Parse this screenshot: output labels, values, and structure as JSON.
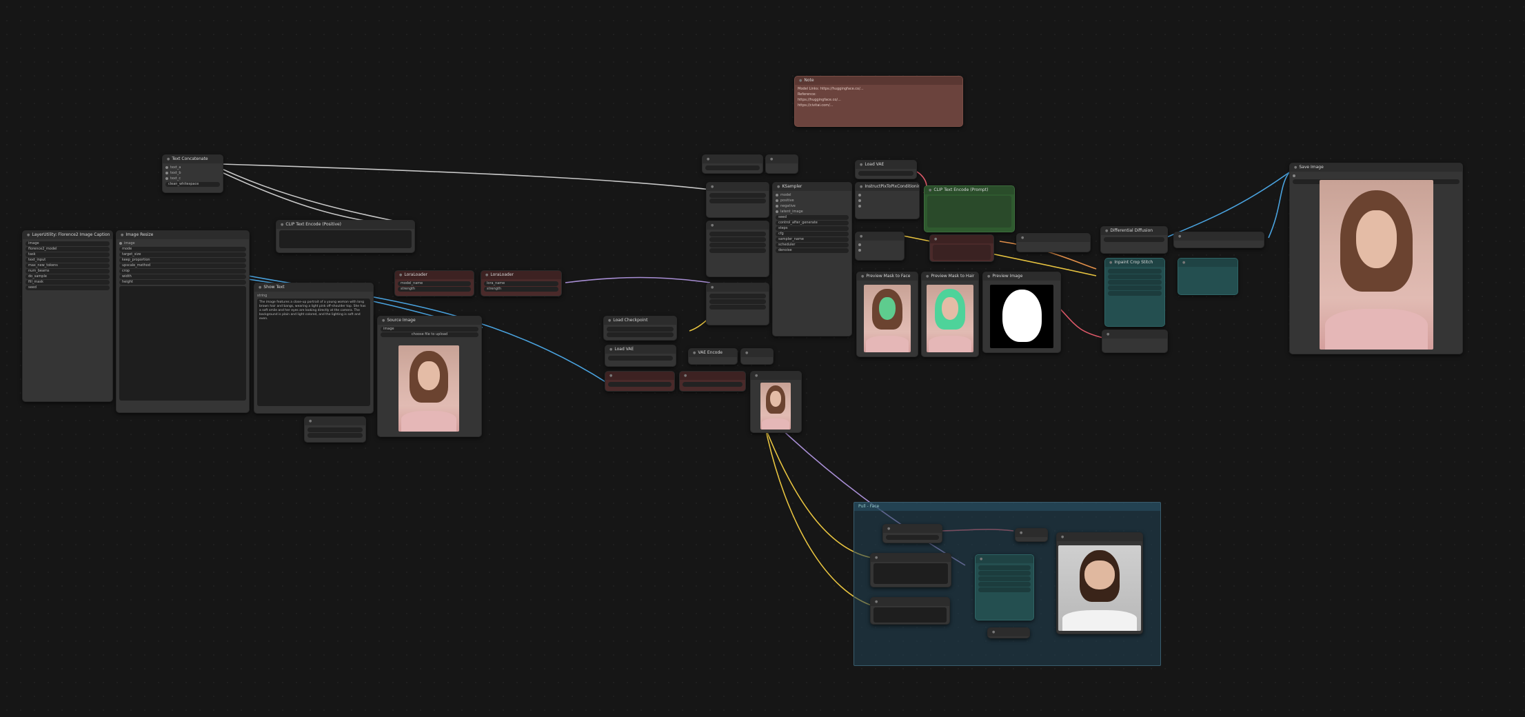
{
  "colors": {
    "background": "#161616",
    "group": "#244456",
    "note": "#6b433d",
    "green_node": "#2f5a2f",
    "teal_node": "#244f50",
    "red_node": "#4a2a2a",
    "wire_blue": "#4aa3df",
    "wire_yellow": "#e8c440",
    "wire_purple": "#a98fd6",
    "wire_red": "#e05a6a",
    "wire_white": "#bbbbbb"
  },
  "nodes": {
    "text_concat": {
      "title": "Text Concatenate",
      "rows": [
        "text_a",
        "text_b",
        "text_c",
        "text_d"
      ],
      "widget": "clean_whitespace",
      "label": "text"
    },
    "ln_sampler": {
      "title": "LayerUtility: Florence2 Image Caption",
      "rows": [
        "image",
        "florence2_model",
        "task",
        "text_input",
        "max_new_tokens",
        "num_beams",
        "do_sample",
        "fill_mask",
        "seed"
      ]
    },
    "resize": {
      "title": "Image Resize",
      "rows": [
        "image",
        "mode",
        "target_size",
        "keep_proportion",
        "upscale_method",
        "crop",
        "width",
        "height"
      ]
    },
    "show_text": {
      "title": "Show Text",
      "label": "string",
      "text": "The image features a close-up portrait of a young woman with long brown hair and bangs, wearing a light pink off-shoulder top. She has a soft smile and her eyes are looking directly at the camera. The background is plain and light colored, and the lighting is soft and even."
    },
    "clip_text_top": {
      "title": "CLIP Text Encode (Positive)"
    },
    "lora_loader1": {
      "title": "LoraLoader",
      "w1": "model_name",
      "w2": "strength"
    },
    "lora_loader2": {
      "title": "LoraLoader",
      "w1": "lora_name",
      "w2": "strength"
    },
    "load_image": {
      "title": "Source Image",
      "w1": "image",
      "w2": "choose file to upload"
    },
    "checkpoint": {
      "title": "Load Checkpoint"
    },
    "vae_encode": {
      "title": "VAE Encode"
    },
    "ksampler": {
      "title": "KSampler",
      "rows": [
        "model",
        "positive",
        "negative",
        "latent_image",
        "seed",
        "control_after_generate",
        "steps",
        "cfg",
        "sampler_name",
        "scheduler",
        "denoise"
      ]
    },
    "load_vae": {
      "title": "Load VAE"
    },
    "instruct_pix": {
      "title": "InstructPixToPixConditioning"
    },
    "clip_text_green": {
      "title": "CLIP Text Encode (Prompt)"
    },
    "preview_face": {
      "title": "Preview Mask to Face"
    },
    "preview_hair": {
      "title": "Preview Mask to Hair"
    },
    "preview_mask": {
      "title": "Preview Image"
    },
    "image_blend": {
      "title": "Differential Diffusion"
    },
    "save_image": {
      "title": "Save Image"
    },
    "float_var": {
      "title": "Inpaint Crop Stitch"
    },
    "note_node": {
      "title": "Note",
      "lines": [
        "Model Links: https://huggingface.co/...",
        "Reference:",
        "https://huggingface.co/...",
        "https://civitai.com/..."
      ]
    },
    "group_title": "Pull - Face"
  }
}
